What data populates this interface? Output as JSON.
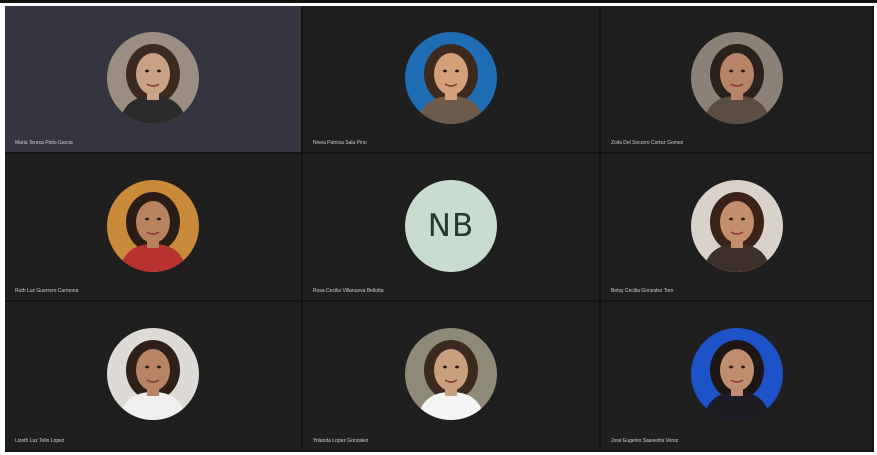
{
  "participants": [
    {
      "name": "Maria Teresa Pinto Garcia",
      "avatar": "photo",
      "bg": "#9a8d82",
      "skin": "#c9a184",
      "hair": "#3a2a22",
      "shirt": "#2d2a2a",
      "active": true
    },
    {
      "name": "Nivea Patricia Sala Pino",
      "avatar": "photo",
      "bg": "#1f6eb5",
      "skin": "#d4a07a",
      "hair": "#3d2a1e",
      "shirt": "#6d5a4a",
      "active": false
    },
    {
      "name": "Zoila Del Socorro Cortez Gomez",
      "avatar": "photo",
      "bg": "#8c8177",
      "skin": "#b88467",
      "hair": "#2b211b",
      "shirt": "#5a4d44",
      "active": false
    },
    {
      "name": "Ruth Luz Guerrero Carmona",
      "avatar": "photo",
      "bg": "#c98a3a",
      "skin": "#b9825e",
      "hair": "#2a1d17",
      "shirt": "#b8332f",
      "active": false
    },
    {
      "name": "Rosa Cecilia Villanueva Bellotta",
      "avatar": "initials",
      "initials": "NB",
      "active": false
    },
    {
      "name": "Betsy Cecilia Gonzalez Toro",
      "avatar": "photo",
      "bg": "#d9d2cb",
      "skin": "#c48e6c",
      "hair": "#3a2218",
      "shirt": "#3c3028",
      "active": false
    },
    {
      "name": "Lizeth Luz Tello Lopez",
      "avatar": "photo",
      "bg": "#dedad6",
      "skin": "#b88463",
      "hair": "#2e2019",
      "shirt": "#f0eeee",
      "active": false
    },
    {
      "name": "Yolanda Lopez Gonzalez",
      "avatar": "photo",
      "bg": "#8f8a78",
      "skin": "#c9a07d",
      "hair": "#3a2a1f",
      "shirt": "#f5f5f5",
      "active": false
    },
    {
      "name": "Jose Eugenio Saavedra Veroz",
      "avatar": "photo",
      "bg": "#1e52c8",
      "skin": "#c08d6e",
      "hair": "#1c1714",
      "shirt": "#1c1c22",
      "active": false
    }
  ]
}
